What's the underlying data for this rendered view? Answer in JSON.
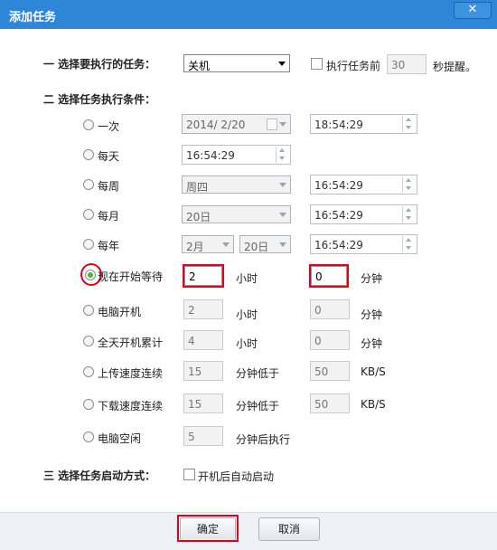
{
  "window": {
    "title": "添加任务",
    "close_glyph": "✕"
  },
  "section1": {
    "label": "一 选择要执行的任务：",
    "task_value": "关机",
    "remind_label": "执行任务前",
    "remind_value": "30",
    "remind_suffix": "秒提醒。"
  },
  "section2": {
    "label": "二 选择任务执行条件：",
    "once": {
      "label": "一次",
      "date": "2014/  2/20",
      "time": "18:54:29"
    },
    "daily": {
      "label": "每天",
      "time": "16:54:29"
    },
    "weekly": {
      "label": "每周",
      "day": "周四",
      "time": "16:54:29"
    },
    "monthly": {
      "label": "每月",
      "day": "20日",
      "time": "16:54:29"
    },
    "yearly": {
      "label": "每年",
      "month": "2月",
      "day": "20日",
      "time": "16:54:29"
    },
    "wait": {
      "label": "现在开始等待",
      "hours": "2",
      "hours_unit": "小时",
      "minutes": "0",
      "minutes_unit": "分钟"
    },
    "boot": {
      "label": "电脑开机",
      "hours": "2",
      "hours_unit": "小时",
      "minutes": "0",
      "minutes_unit": "分钟"
    },
    "uptime": {
      "label": "全天开机累计",
      "hours": "4",
      "hours_unit": "小时",
      "minutes": "0",
      "minutes_unit": "分钟"
    },
    "upload": {
      "label": "上传速度连续",
      "minutes": "15",
      "minutes_unit": "分钟低于",
      "speed": "50",
      "speed_unit": "KB/S"
    },
    "download": {
      "label": "下载速度连续",
      "minutes": "15",
      "minutes_unit": "分钟低于",
      "speed": "50",
      "speed_unit": "KB/S"
    },
    "idle": {
      "label": "电脑空闲",
      "minutes": "5",
      "minutes_unit": "分钟后执行"
    }
  },
  "section3": {
    "label": "三 选择任务启动方式：",
    "autostart_label": "开机后自动启动"
  },
  "footer": {
    "ok_label": "确定",
    "cancel_label": "取消"
  },
  "colors": {
    "titlebar": "#2e86d8",
    "highlight": "#e0001a",
    "radio_selected": "#4ab33a"
  }
}
